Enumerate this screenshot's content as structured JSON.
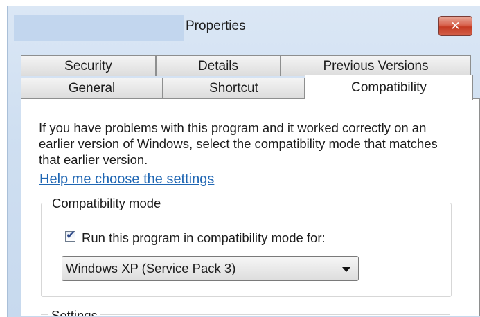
{
  "window": {
    "title": "Properties",
    "close_symbol": "✕",
    "accent_color": "#c43a22"
  },
  "tabs": {
    "row_back": [
      {
        "label": "Security"
      },
      {
        "label": "Details"
      },
      {
        "label": "Previous Versions"
      }
    ],
    "row_front": [
      {
        "label": "General"
      },
      {
        "label": "Shortcut"
      },
      {
        "label": "Compatibility",
        "active": true
      }
    ]
  },
  "panel": {
    "description": "If you have problems with this program and it worked correctly on an earlier version of Windows, select the compatibility mode that matches that earlier version.",
    "help_link": "Help me choose the settings",
    "link_color": "#1f66b3",
    "compat_group": {
      "label": "Compatibility mode",
      "checkbox_label": "Run this program in compatibility mode for:",
      "checkbox_checked": true,
      "select_value": "Windows XP (Service Pack 3)"
    },
    "settings_group": {
      "label": "Settings"
    }
  }
}
